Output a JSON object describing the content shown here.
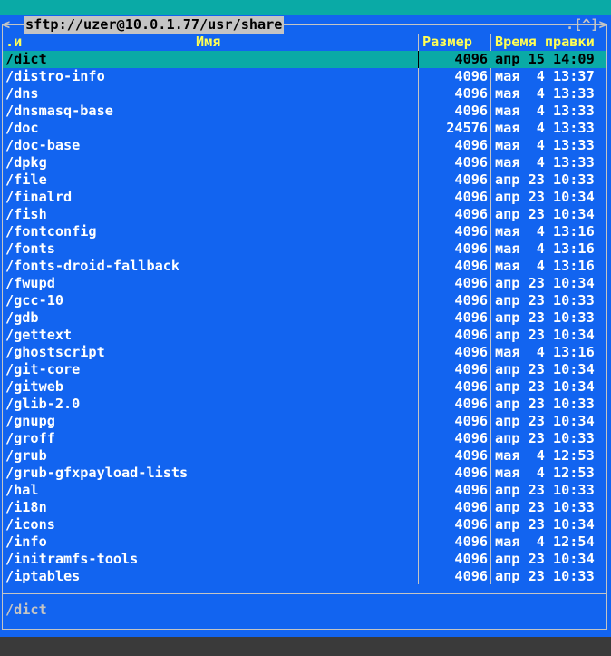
{
  "window": {
    "title": "sftp://uzer@10.0.1.77/usr/share",
    "corner_left": "<",
    "corner_right": ".[^]>"
  },
  "columns": {
    "sort_indicator": ".и",
    "name": "Имя",
    "size": "Размер",
    "time": "Время правки"
  },
  "files": [
    {
      "name": "/dict",
      "size": "4096",
      "time": "апр 15 14:09",
      "selected": true
    },
    {
      "name": "/distro-info",
      "size": "4096",
      "time": "мая  4 13:37"
    },
    {
      "name": "/dns",
      "size": "4096",
      "time": "мая  4 13:33"
    },
    {
      "name": "/dnsmasq-base",
      "size": "4096",
      "time": "мая  4 13:33"
    },
    {
      "name": "/doc",
      "size": "24576",
      "time": "мая  4 13:33"
    },
    {
      "name": "/doc-base",
      "size": "4096",
      "time": "мая  4 13:33"
    },
    {
      "name": "/dpkg",
      "size": "4096",
      "time": "мая  4 13:33"
    },
    {
      "name": "/file",
      "size": "4096",
      "time": "апр 23 10:33"
    },
    {
      "name": "/finalrd",
      "size": "4096",
      "time": "апр 23 10:34"
    },
    {
      "name": "/fish",
      "size": "4096",
      "time": "апр 23 10:34"
    },
    {
      "name": "/fontconfig",
      "size": "4096",
      "time": "мая  4 13:16"
    },
    {
      "name": "/fonts",
      "size": "4096",
      "time": "мая  4 13:16"
    },
    {
      "name": "/fonts-droid-fallback",
      "size": "4096",
      "time": "мая  4 13:16"
    },
    {
      "name": "/fwupd",
      "size": "4096",
      "time": "апр 23 10:34"
    },
    {
      "name": "/gcc-10",
      "size": "4096",
      "time": "апр 23 10:33"
    },
    {
      "name": "/gdb",
      "size": "4096",
      "time": "апр 23 10:33"
    },
    {
      "name": "/gettext",
      "size": "4096",
      "time": "апр 23 10:34"
    },
    {
      "name": "/ghostscript",
      "size": "4096",
      "time": "мая  4 13:16"
    },
    {
      "name": "/git-core",
      "size": "4096",
      "time": "апр 23 10:34"
    },
    {
      "name": "/gitweb",
      "size": "4096",
      "time": "апр 23 10:34"
    },
    {
      "name": "/glib-2.0",
      "size": "4096",
      "time": "апр 23 10:33"
    },
    {
      "name": "/gnupg",
      "size": "4096",
      "time": "апр 23 10:34"
    },
    {
      "name": "/groff",
      "size": "4096",
      "time": "апр 23 10:33"
    },
    {
      "name": "/grub",
      "size": "4096",
      "time": "мая  4 12:53"
    },
    {
      "name": "/grub-gfxpayload-lists",
      "size": "4096",
      "time": "мая  4 12:53"
    },
    {
      "name": "/hal",
      "size": "4096",
      "time": "апр 23 10:33"
    },
    {
      "name": "/i18n",
      "size": "4096",
      "time": "апр 23 10:33"
    },
    {
      "name": "/icons",
      "size": "4096",
      "time": "апр 23 10:34"
    },
    {
      "name": "/info",
      "size": "4096",
      "time": "мая  4 12:54"
    },
    {
      "name": "/initramfs-tools",
      "size": "4096",
      "time": "апр 23 10:34"
    },
    {
      "name": "/iptables",
      "size": "4096",
      "time": "апр 23 10:33"
    }
  ],
  "mini_status": "/dict",
  "colors": {
    "panel_bg": "#1264f0",
    "selection_bg": "#0aaaa6",
    "header_text": "#ffff55",
    "frame": "#c4c4c4"
  }
}
